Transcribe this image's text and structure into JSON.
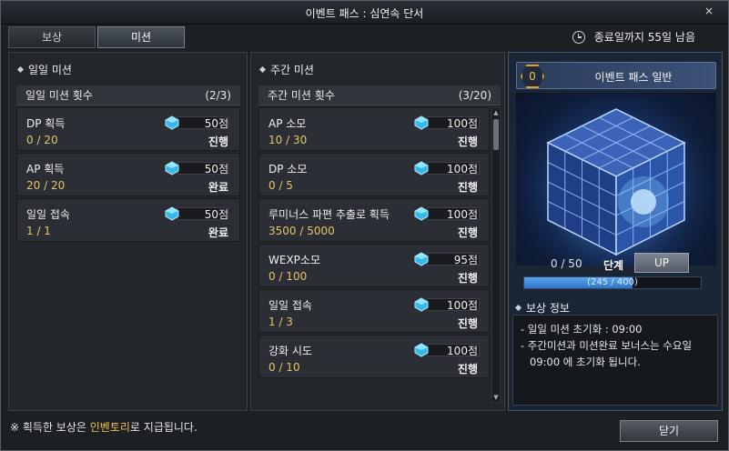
{
  "window": {
    "title": "이벤트 패스 : 심연속 단서",
    "close_glyph": "×"
  },
  "tabs": [
    {
      "label": "보상",
      "active": false
    },
    {
      "label": "미션",
      "active": true
    }
  ],
  "timer": {
    "text": "종료일까지 55일 남음"
  },
  "daily": {
    "heading": "일일 미션",
    "count_label": "일일 미션 횟수",
    "count_value": "(2/3)",
    "items": [
      {
        "name": "DP 획득",
        "progress": "0 / 20",
        "points": "50점",
        "status": "진행"
      },
      {
        "name": "AP 획득",
        "progress": "20 / 20",
        "points": "50점",
        "status": "완료"
      },
      {
        "name": "일일 접속",
        "progress": "1 / 1",
        "points": "50점",
        "status": "완료"
      }
    ]
  },
  "weekly": {
    "heading": "주간 미션",
    "count_label": "주간 미션 횟수",
    "count_value": "(3/20)",
    "items": [
      {
        "name": "AP 소모",
        "progress": "10 / 30",
        "points": "100점",
        "status": "진행"
      },
      {
        "name": "DP 소모",
        "progress": "0 / 5",
        "points": "100점",
        "status": "진행"
      },
      {
        "name": "루미너스 파편 추출로 획득",
        "progress": "3500 / 5000",
        "points": "100점",
        "status": "진행"
      },
      {
        "name": "WEXP소모",
        "progress": "0 / 100",
        "points": "95점",
        "status": "진행"
      },
      {
        "name": "일일 접속",
        "progress": "1 / 3",
        "points": "100점",
        "status": "진행"
      },
      {
        "name": "강화 시도",
        "progress": "0 / 10",
        "points": "100점",
        "status": "진행"
      }
    ]
  },
  "pass": {
    "level": "0",
    "title": "이벤트 패스 일반",
    "stage_count": "0 / 50",
    "stage_label": "단계",
    "up_label": "UP",
    "xp_text": "(245 / 400)",
    "xp_fraction": 0.6125,
    "reward_heading": "보상 정보",
    "reward_lines": [
      "- 일일 미션 초기화 : 09:00",
      "- 주간미션과 미션완료 보너스는 수요일",
      "09:00 에 초기화 됩니다."
    ]
  },
  "footer": {
    "note_prefix": "※ 획득한 보상은 ",
    "note_highlight": "인벤토리",
    "note_suffix": "로 지급됩니다.",
    "close_label": "닫기"
  },
  "colors": {
    "accent_gold": "#e5c463",
    "gem_cyan": "#4fd4ff",
    "xp_blue": "#3f8fe0"
  }
}
